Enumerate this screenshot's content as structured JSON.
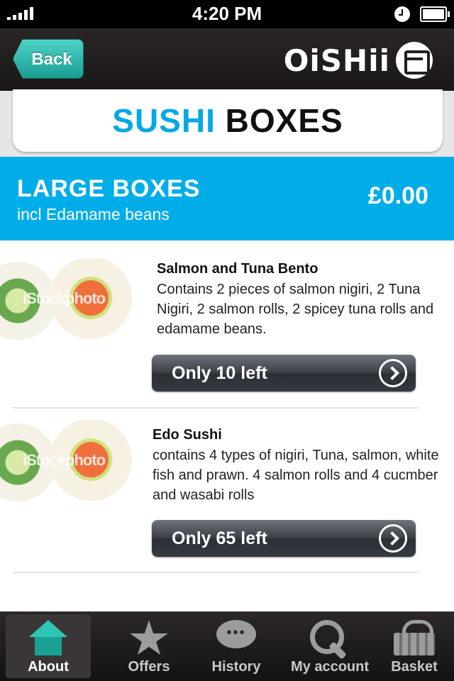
{
  "status_bar": {
    "time": "4:20 PM"
  },
  "nav": {
    "back_label": "Back",
    "brand": "OiSHii"
  },
  "title": {
    "accent": "SUSHI",
    "main": "BOXES"
  },
  "category": {
    "title": "LARGE BOXES",
    "subtitle": "incl Edamame beans",
    "price": "£0.00"
  },
  "products": [
    {
      "name": "Salmon and Tuna Bento",
      "description": "Contains 2 pieces of salmon nigiri, 2 Tuna Nigiri, 2 salmon rolls, 2 spicey tuna rolls and edamame beans.",
      "stock_label": "Only 10 left",
      "image_watermark": "iStockphoto"
    },
    {
      "name": "Edo Sushi",
      "description": "contains 4 types of nigiri, Tuna, salmon, white fish and prawn. 4 salmon rolls and 4 cucmber and wasabi rolls",
      "stock_label": "Only 65 left",
      "image_watermark": "iStockphoto"
    }
  ],
  "tabs": [
    {
      "label": "About",
      "icon": "house-icon",
      "active": true
    },
    {
      "label": "Offers",
      "icon": "star-icon"
    },
    {
      "label": "History",
      "icon": "chat-icon"
    },
    {
      "label": "My account",
      "icon": "magnifier-icon"
    },
    {
      "label": "Basket",
      "icon": "basket-icon"
    }
  ],
  "colors": {
    "accent": "#00ade9",
    "back_button": "#1aa193",
    "nav_bg": "#231f1f"
  }
}
